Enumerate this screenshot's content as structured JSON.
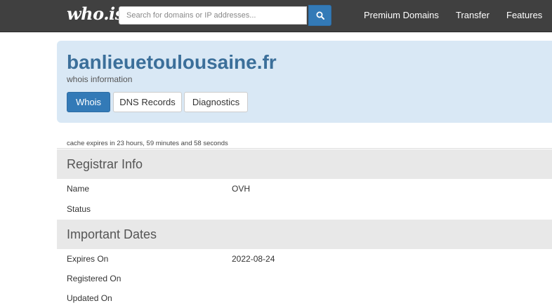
{
  "header": {
    "logo": "who.is",
    "search_placeholder": "Search for domains or IP addresses...",
    "nav": [
      "Premium Domains",
      "Transfer",
      "Features"
    ]
  },
  "domain": {
    "name": "banlieuetoulousaine.fr",
    "subtitle": "whois information",
    "tabs": [
      "Whois",
      "DNS Records",
      "Diagnostics"
    ],
    "active_tab": "Whois"
  },
  "cache_note": "cache expires in 23 hours, 59 minutes and 58 seconds",
  "registrar": {
    "title": "Registrar Info",
    "rows": [
      {
        "label": "Name",
        "value": "OVH"
      },
      {
        "label": "Status",
        "value": ""
      }
    ]
  },
  "dates": {
    "title": "Important Dates",
    "rows": [
      {
        "label": "Expires On",
        "value": "2022-08-24"
      },
      {
        "label": "Registered On",
        "value": ""
      },
      {
        "label": "Updated On",
        "value": ""
      }
    ]
  },
  "colors": {
    "navbar": "#404040",
    "accent": "#337ab7",
    "jumbotron": "#d9e8f5",
    "title": "#3b6f9a"
  }
}
